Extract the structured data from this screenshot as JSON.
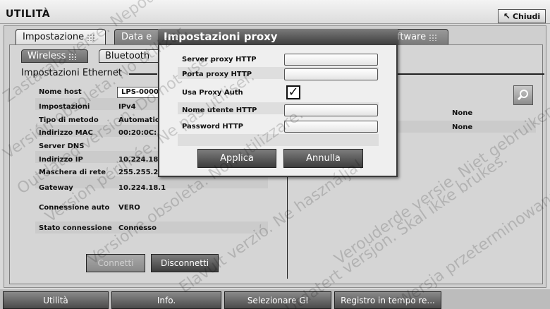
{
  "window": {
    "title": "UTILITÀ",
    "close_label": "Chiudi",
    "close_icon": "arrow-icon"
  },
  "top_tabs": [
    {
      "label": "Impostazione",
      "active": true
    },
    {
      "label": "Data e",
      "active": false
    },
    {
      "label": "ftware",
      "active": false
    }
  ],
  "sub_tabs": [
    {
      "label": "Wireless",
      "active": true
    },
    {
      "label": "Bluetooth",
      "active": false
    }
  ],
  "ethernet": {
    "section_title": "Impostazioni Ethernet",
    "rows": [
      {
        "label": "Nome host",
        "value": "LPS-0000"
      },
      {
        "label": "Impostazioni",
        "value": "IPv4"
      },
      {
        "label": "Tipo di metodo",
        "value": "Automatic"
      },
      {
        "label": "Indirizzo MAC",
        "value": "00:20:0C:"
      },
      {
        "label": "Server DNS",
        "value": ""
      },
      {
        "label": "Indirizzo IP",
        "value": "10.224.18"
      },
      {
        "label": "Maschera di rete",
        "value": "255.255.2"
      },
      {
        "label": "Gateway",
        "value": "10.224.18.1"
      },
      {
        "label": "Connessione auto",
        "value": "VERO"
      },
      {
        "label": "Stato connessione",
        "value": "Connesso"
      }
    ],
    "connect_label": "Connetti",
    "disconnect_label": "Disconnetti"
  },
  "right_panel": {
    "values": [
      "None",
      "None"
    ],
    "zoom_icon": "magnifier-icon"
  },
  "proxy_dialog": {
    "title": "Impostazioni proxy",
    "fields": [
      {
        "label": "Server proxy HTTP",
        "value": ""
      },
      {
        "label": "Porta proxy HTTP",
        "value": ""
      },
      {
        "label": "Usa Proxy Auth",
        "checked": true
      },
      {
        "label": "Nome utente HTTP",
        "value": ""
      },
      {
        "label": "Password HTTP",
        "value": ""
      }
    ],
    "apply_label": "Applica",
    "cancel_label": "Annulla"
  },
  "bottom_nav": [
    {
      "label": "Utilità"
    },
    {
      "label": "Info."
    },
    {
      "label": "Selezionare GI"
    },
    {
      "label": "Registro in tempo re..."
    }
  ],
  "watermark_lines": [
    "Versión obsoleta. No utilizar.",
    "Outdated version. Do not use.",
    "Version périmée. Ne pas utiliser.",
    "Zastaralá verze. Nepoužívat.",
    "Versione obsoleta. Non utilizzare.",
    "Elavult verzió. Ne használja!",
    "Verouderde versie. Niet gebruiken.",
    "Wersja przeterminowana. Nie używać.",
    "Utdatert versjon. Skal ikke brukes."
  ]
}
